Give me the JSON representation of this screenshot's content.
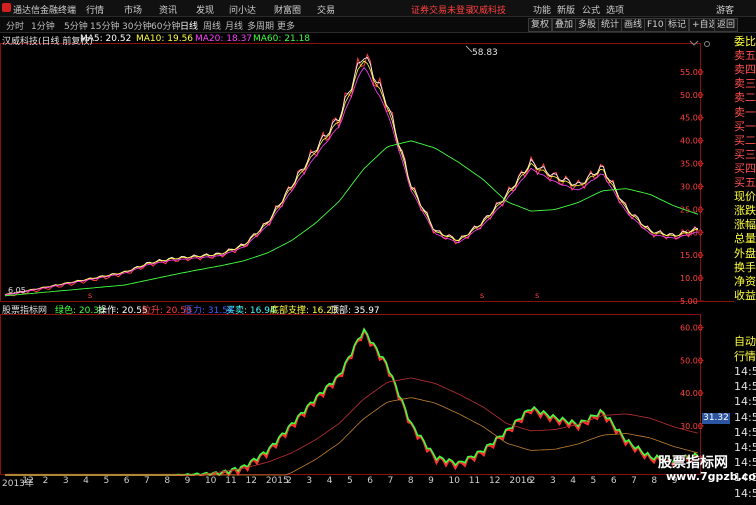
{
  "app": {
    "title": "通达信金融终端"
  },
  "menu": [
    "行情",
    "市场",
    "资讯",
    "发现",
    "问小达",
    "财富圈",
    "交易"
  ],
  "status": {
    "login_note": "证券交易未登录",
    "stock_tag": "汉威科技"
  },
  "right_menu": [
    "功能",
    "新版",
    "公式",
    "选项",
    "游客"
  ],
  "periods": [
    {
      "label": "分时",
      "active": false
    },
    {
      "label": "1分钟",
      "active": false
    },
    {
      "label": "5分钟",
      "active": false
    },
    {
      "label": "15分钟",
      "active": false
    },
    {
      "label": "30分钟",
      "active": false
    },
    {
      "label": "60分钟",
      "active": false
    },
    {
      "label": "日线",
      "active": true
    },
    {
      "label": "周线",
      "active": false
    },
    {
      "label": "月线",
      "active": false
    },
    {
      "label": "多周期",
      "active": false
    },
    {
      "label": "更多",
      "active": false
    }
  ],
  "toolbar_buttons": [
    "复权",
    "叠加",
    "多股",
    "统计",
    "画线",
    "F10",
    "标记",
    "+自选",
    "返回"
  ],
  "main_chart": {
    "stock_label": "汉威科技(日线 前复权)",
    "ma": [
      {
        "label": "MA5: 20.52",
        "color": "#ffffff"
      },
      {
        "label": "MA10: 19.56",
        "color": "#ffff40"
      },
      {
        "label": "MA20: 18.37",
        "color": "#ff40ff"
      },
      {
        "label": "MA60: 21.18",
        "color": "#40ff40"
      }
    ],
    "high_label": "58.83",
    "low_label": "6.05",
    "y_ticks": [
      "55.00",
      "50.00",
      "45.00",
      "40.00",
      "35.00",
      "30.00",
      "25.00",
      "20.00",
      "15.00",
      "10.00",
      "5.00"
    ]
  },
  "indicator": {
    "name": "股票指标网",
    "items": [
      {
        "label": "绿色: 20.30",
        "color": "#40ff40"
      },
      {
        "label": "操作: 20.55",
        "color": "#ffffff"
      },
      {
        "label": "拉升: 20.58",
        "color": "#ff4040"
      },
      {
        "label": "压力: 31.58",
        "color": "#4060ff"
      },
      {
        "label": "买卖: 16.94",
        "color": "#40ffff"
      },
      {
        "label": "底部支撑: 16.23",
        "color": "#ffff40"
      },
      {
        "label": "顶部: 35.97",
        "color": "#ffffff"
      }
    ],
    "y_ticks": [
      "60.00",
      "50.00",
      "40.00",
      "30.00",
      "20.00"
    ],
    "price_tag": "31.32"
  },
  "x_axis": [
    "2013年",
    "12",
    "2",
    "3",
    "4",
    "5",
    "6",
    "7",
    "8",
    "9",
    "10",
    "11",
    "12",
    "2015",
    "2",
    "3",
    "4",
    "5",
    "6",
    "7",
    "8",
    "9",
    "10",
    "11",
    "12",
    "2016",
    "2",
    "3",
    "4",
    "5",
    "6",
    "7",
    "8",
    "9"
  ],
  "sidebar": {
    "items": [
      {
        "label": "委比",
        "color": "yel"
      },
      {
        "label": "卖五",
        "color": "red"
      },
      {
        "label": "卖四",
        "color": "red"
      },
      {
        "label": "卖三",
        "color": "red"
      },
      {
        "label": "卖二",
        "color": "red"
      },
      {
        "label": "卖一",
        "color": "red"
      },
      {
        "label": "买一",
        "color": "red"
      },
      {
        "label": "买二",
        "color": "red"
      },
      {
        "label": "买三",
        "color": "red"
      },
      {
        "label": "买四",
        "color": "red"
      },
      {
        "label": "买五",
        "color": "red"
      },
      {
        "label": "现价",
        "color": "yel"
      },
      {
        "label": "涨跌",
        "color": "yel"
      },
      {
        "label": "涨幅",
        "color": "yel"
      },
      {
        "label": "总量",
        "color": "yel"
      },
      {
        "label": "外盘",
        "color": "yel"
      },
      {
        "label": "换手",
        "color": "yel"
      },
      {
        "label": "净资",
        "color": "yel"
      },
      {
        "label": "收益",
        "color": "yel"
      }
    ],
    "section_labels": [
      "自动",
      "行情"
    ],
    "times": [
      "14:50",
      "14:50",
      "14:50",
      "14:50",
      "14:50",
      "14:50",
      "14:50",
      "14:50",
      "14:50"
    ]
  },
  "watermark": {
    "main": "股票指标网",
    "sub": "www.7gpzb.com"
  },
  "chart_data": {
    "type": "line",
    "title": "汉威科技(日线 前复权)",
    "price_series_approx": [
      6.05,
      7,
      8,
      9,
      10,
      11,
      13,
      14,
      14.5,
      15,
      17,
      22,
      30,
      38,
      45,
      58.83,
      48,
      30,
      20,
      18,
      22,
      28,
      35,
      32,
      30,
      34,
      25,
      20,
      19,
      20.5
    ],
    "ma_values_last": {
      "MA5": 20.52,
      "MA10": 19.56,
      "MA20": 18.37,
      "MA60": 21.18
    },
    "ylim": [
      5,
      60
    ],
    "indicator_ylim": [
      15,
      62
    ]
  }
}
